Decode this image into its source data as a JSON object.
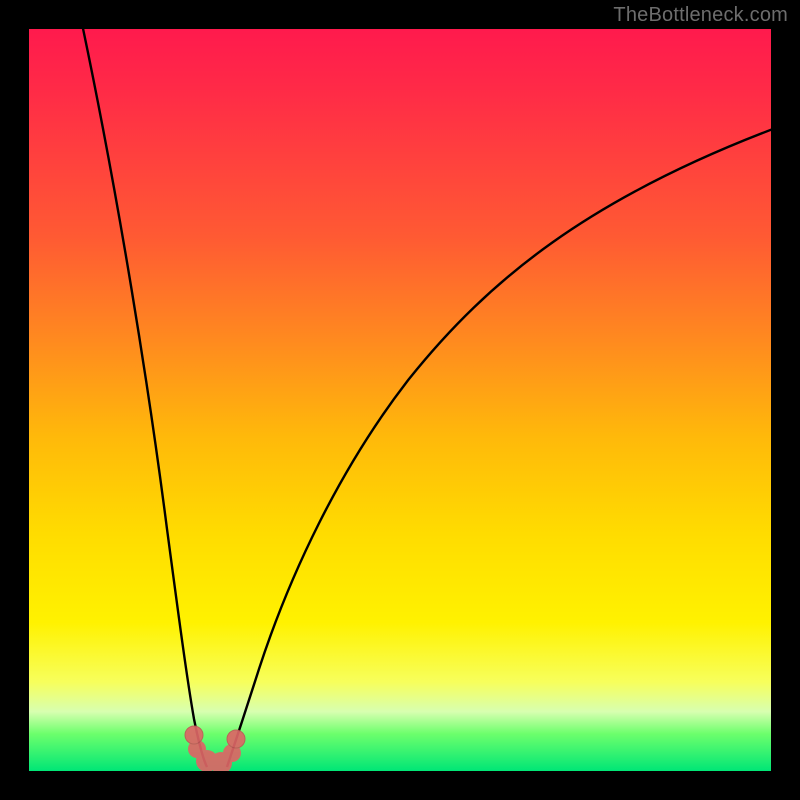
{
  "attribution": "TheBottleneck.com",
  "colors": {
    "background_frame": "#000000",
    "gradient_top": "#ff1a4d",
    "gradient_mid": "#ffdc00",
    "gradient_bottom": "#00e676",
    "curve_stroke": "#000000",
    "valley_marker": "#d66"
  },
  "chart_data": {
    "type": "line",
    "title": "",
    "xlabel": "",
    "ylabel": "",
    "xlim": [
      0,
      100
    ],
    "ylim": [
      0,
      100
    ],
    "background": "vertical red→yellow→green gradient; green = optimal (low), red = worst (high)",
    "series": [
      {
        "name": "left-branch",
        "x": [
          7,
          10,
          13,
          16,
          18,
          20,
          22,
          23.5,
          24
        ],
        "y": [
          100,
          82,
          62,
          44,
          30,
          18,
          9,
          3,
          0.5
        ]
      },
      {
        "name": "right-branch",
        "x": [
          26.5,
          28,
          31,
          36,
          44,
          54,
          66,
          80,
          100
        ],
        "y": [
          0.5,
          4,
          12,
          26,
          42,
          56,
          70,
          80,
          87
        ]
      }
    ],
    "annotations": [
      {
        "name": "valley-cluster",
        "shape": "lobed-marker",
        "approx_x_range": [
          22,
          28
        ],
        "approx_y_range": [
          0,
          6
        ],
        "color": "#d66"
      }
    ],
    "minimum": {
      "x": 25,
      "y": 0
    }
  }
}
